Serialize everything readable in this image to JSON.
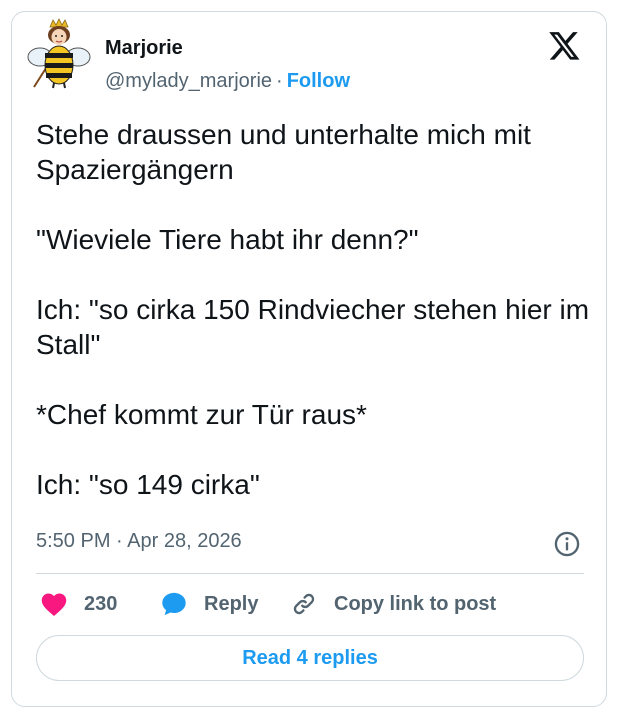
{
  "author": {
    "name": "Marjorie",
    "handle": "@mylady_marjorie",
    "separator": "·",
    "follow_label": "Follow"
  },
  "tweet": {
    "paragraphs": [
      "Stehe draussen und unterhalte mich mit Spaziergängern",
      "\"Wieviele Tiere habt ihr denn?\"",
      "Ich: \"so cirka 150 Rindviecher stehen hier im Stall\"",
      "*Chef kommt zur Tür raus*",
      "Ich: \"so 149 cirka\""
    ],
    "timestamp": "5:50 PM · Apr 28, 2026"
  },
  "actions": {
    "like_count": "230",
    "reply_label": "Reply",
    "copy_link_label": "Copy link to post"
  },
  "read_replies_label": "Read 4 replies",
  "icons": {
    "brand": "x-logo-icon",
    "info": "info-icon",
    "like": "heart-icon",
    "reply": "speech-bubble-icon",
    "copy": "link-icon"
  },
  "colors": {
    "accent": "#1d9bf0",
    "heart": "#f91880",
    "text": "#0f1419",
    "secondary": "#536471",
    "border": "#cfd9de"
  }
}
